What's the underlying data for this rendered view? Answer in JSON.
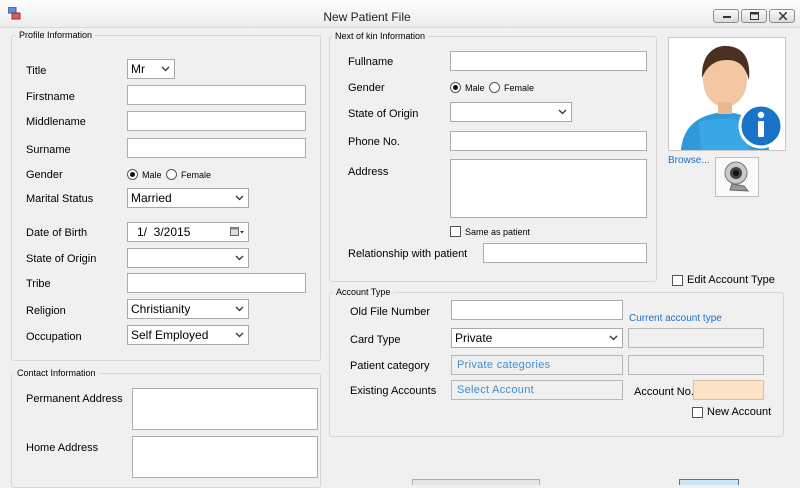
{
  "window": {
    "title": "New Patient File"
  },
  "profile": {
    "legend": "Profile Information",
    "title_label": "Title",
    "title_value": "Mr",
    "firstname_label": "Firstname",
    "middlename_label": "Middlename",
    "surname_label": "Surname",
    "gender_label": "Gender",
    "male_label": "Male",
    "female_label": "Female",
    "marital_label": "Marital Status",
    "marital_value": "Married",
    "dob_label": "Date of Birth",
    "dob_value": "1/  3/2015",
    "state_label": "State of Origin",
    "tribe_label": "Tribe",
    "religion_label": "Religion",
    "religion_value": "Christianity",
    "occupation_label": "Occupation",
    "occupation_value": "Self Employed"
  },
  "contact": {
    "legend": "Contact Information",
    "permanent_label": "Permanent Address",
    "home_label": "Home Address"
  },
  "kin": {
    "legend": "Next of kin Information",
    "fullname_label": "Fullname",
    "gender_label": "Gender",
    "male_label": "Male",
    "female_label": "Female",
    "state_label": "State of Origin",
    "phone_label": "Phone No.",
    "address_label": "Address",
    "same_as_patient_label": "Same as patient",
    "relationship_label": "Relationship with patient"
  },
  "photo": {
    "browse_label": "Browse..."
  },
  "account": {
    "edit_type_label": "Edit Account Type",
    "legend": "Account Type",
    "old_file_label": "Old File Number",
    "current_type_link": "Current account type",
    "card_type_label": "Card Type",
    "card_type_value": "Private",
    "patient_category_label": "Patient category",
    "patient_category_value": "Private categories",
    "existing_label": "Existing Accounts",
    "existing_value": "Select Account",
    "account_no_label": "Account No.",
    "new_account_label": "New Account"
  },
  "colors": {
    "window_bg": "#f0f0f0",
    "link": "#1f6fc3",
    "account_no_field": "#fde3c7",
    "category_text": "#3c8fd0"
  }
}
